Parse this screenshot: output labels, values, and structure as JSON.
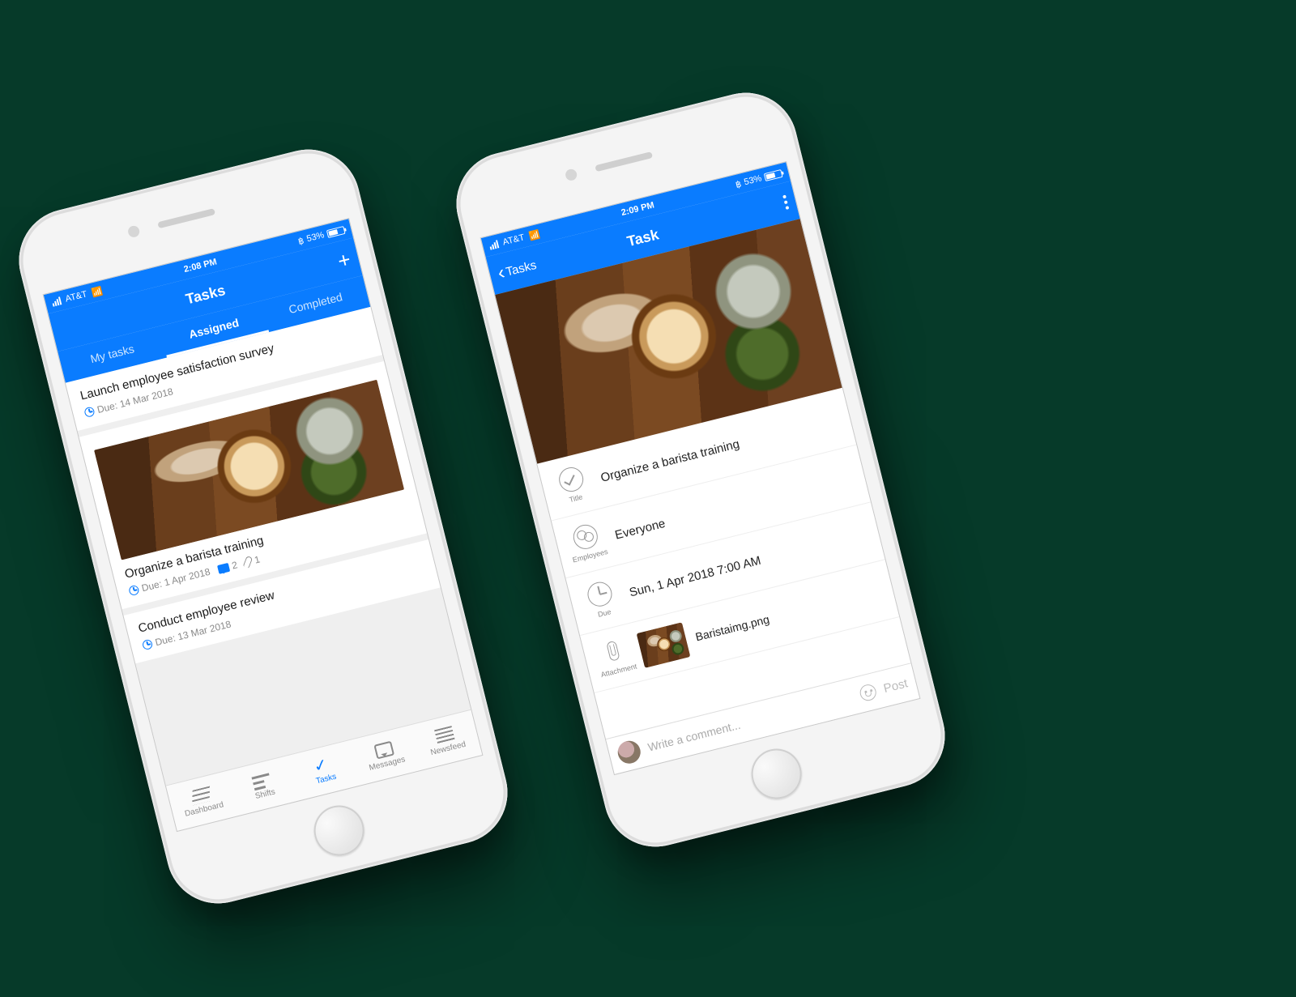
{
  "status_bar": {
    "carrier": "AT&T",
    "time": "2:08 PM",
    "time_detail": "2:09 PM",
    "battery_pct": "53%",
    "bluetooth_glyph": "฿"
  },
  "phone_tasks": {
    "nav_title": "Tasks",
    "nav_add_glyph": "+",
    "tabs": [
      "My tasks",
      "Assigned",
      "Completed"
    ],
    "active_tab_index": 1,
    "cards": [
      {
        "title": "Launch employee satisfaction survey",
        "due": "Due: 14 Mar 2018"
      },
      {
        "title": "Organize a barista training",
        "due": "Due: 1 Apr 2018",
        "comments": "2",
        "attachments": "1",
        "has_image": true
      },
      {
        "title": "Conduct employee review",
        "due": "Due: 13 Mar 2018"
      }
    ],
    "bottom_tabs": [
      {
        "label": "Dashboard"
      },
      {
        "label": "Shifts"
      },
      {
        "label": "Tasks"
      },
      {
        "label": "Messages"
      },
      {
        "label": "Newsfeed"
      }
    ],
    "active_bottom_index": 2
  },
  "phone_detail": {
    "nav_back": "Tasks",
    "nav_title": "Task",
    "rows": {
      "title_label": "Title",
      "title_value": "Organize a barista training",
      "employees_label": "Employees",
      "employees_value": "Everyone",
      "due_label": "Due",
      "due_value": "Sun, 1 Apr 2018 7:00 AM",
      "attachment_label": "Attachment",
      "attachment_value": "Baristaimg.png"
    },
    "comment_placeholder": "Write a comment...",
    "post_label": "Post"
  }
}
